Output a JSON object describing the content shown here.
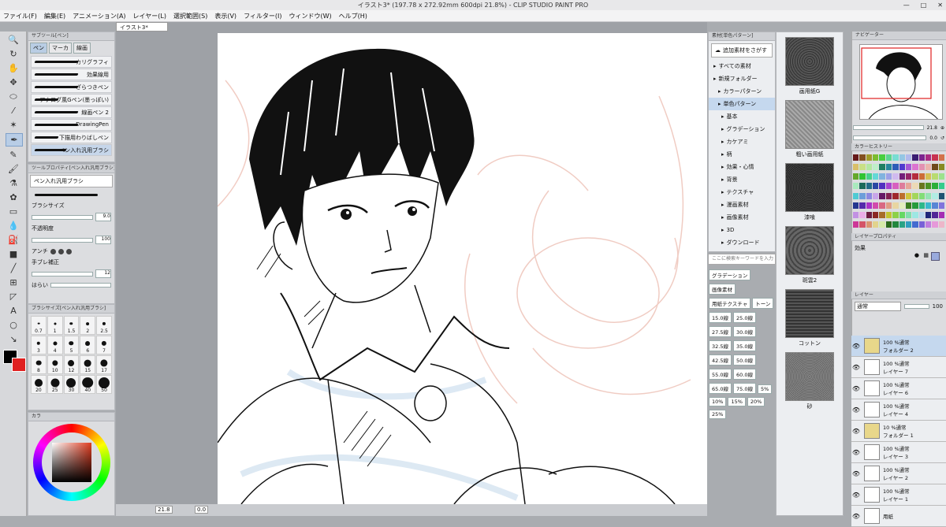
{
  "window": {
    "title": "イラスト3* (197.78 x 272.92mm 600dpi 21.8%) - CLIP STUDIO PAINT PRO"
  },
  "menu": [
    "ファイル(F)",
    "編集(E)",
    "アニメーション(A)",
    "レイヤー(L)",
    "選択範囲(S)",
    "表示(V)",
    "フィルター(I)",
    "ウィンドウ(W)",
    "ヘルプ(H)"
  ],
  "subtool": {
    "header": "サブツール[ペン]",
    "tabs": [
      "ペン",
      "マーカ",
      "線画"
    ],
    "brushes": [
      "カリグラフィ",
      "効果線用",
      "ざらつきペン",
      "アナログ風Gペン(墨っぽい)",
      "線画ペン 2",
      "DrawingPen",
      "下描用わりばしペン",
      "ペン入れ汎用ブラシ"
    ]
  },
  "toolprop": {
    "header": "ツールプロパティ[ペン入れ汎用ブラシ]",
    "name": "ペン入れ汎用ブラシ",
    "rows": [
      {
        "label": "ブラシサイズ",
        "value": "9.0"
      },
      {
        "label": "不透明度",
        "value": "100"
      },
      {
        "label": "アンチ",
        "value": ""
      },
      {
        "label": "手ブレ補正",
        "value": "12"
      },
      {
        "label": "はらい",
        "value": ""
      }
    ]
  },
  "brushsize": {
    "header": "ブラシサイズ[ペン入れ汎用ブラシ]",
    "sizes": [
      "0.7",
      "1",
      "1.5",
      "2",
      "2.5",
      "3",
      "4",
      "5",
      "6",
      "7",
      "8",
      "10",
      "12",
      "15",
      "17",
      "20",
      "25",
      "30",
      "40",
      "50"
    ]
  },
  "colorwheel": {
    "header": "カラ"
  },
  "document": {
    "tab": "イラスト3*"
  },
  "status": {
    "zoom": "21.8",
    "rotation": "0.0"
  },
  "material": {
    "header": "素材[単色パターン]",
    "add": "追加素材をさがす",
    "tree": [
      {
        "label": "すべての素材",
        "sel": false
      },
      {
        "label": "新規フォルダー",
        "sel": false
      },
      {
        "label": "カラーパターン",
        "sel": false
      },
      {
        "label": "単色パターン",
        "sel": true
      },
      {
        "label": "基本",
        "sel": false
      },
      {
        "label": "グラデーション",
        "sel": false
      },
      {
        "label": "カケアミ",
        "sel": false
      },
      {
        "label": "柄",
        "sel": false
      },
      {
        "label": "効果・心情",
        "sel": false
      },
      {
        "label": "背景",
        "sel": false
      },
      {
        "label": "テクスチャ",
        "sel": false
      },
      {
        "label": "漫画素材",
        "sel": false
      },
      {
        "label": "画像素材",
        "sel": false
      },
      {
        "label": "3D",
        "sel": false
      },
      {
        "label": "ダウンロード",
        "sel": false
      }
    ],
    "search_placeholder": "ここに検索キーワードを入力",
    "tags": [
      "グラデーション",
      "画像素材",
      "用紙テクスチャ",
      "トーン",
      "15.0線",
      "25.0線",
      "27.5線",
      "30.0線",
      "32.5線",
      "35.0線",
      "42.5線",
      "50.0線",
      "55.0線",
      "60.0線",
      "65.0線",
      "75.0線",
      "5%",
      "10%",
      "15%",
      "20%",
      "25%"
    ],
    "thumbs": [
      "画用紙G",
      "粗い画用紙",
      "漆喰",
      "斑雲2",
      "コットン",
      "砂"
    ]
  },
  "navigator": {
    "header": "ナビゲーター",
    "zoom": "21.8",
    "angle": "0.0"
  },
  "colorhistory": {
    "header": "カラーヒストリー"
  },
  "layerprop": {
    "header": "レイヤープロパティ",
    "effect": "効果"
  },
  "layers": {
    "header": "レイヤー",
    "blend": "通常",
    "opacity": "100",
    "items": [
      {
        "mode": "100 %通常",
        "name": "フォルダー 2",
        "sel": true
      },
      {
        "mode": "100 %通常",
        "name": "レイヤー 7",
        "sel": false
      },
      {
        "mode": "100 %通常",
        "name": "レイヤー 6",
        "sel": false
      },
      {
        "mode": "100 %通常",
        "name": "レイヤー 4",
        "sel": false
      },
      {
        "mode": "10 %通常",
        "name": "フォルダー 1",
        "sel": false
      },
      {
        "mode": "100 %通常",
        "name": "レイヤー 3",
        "sel": false
      },
      {
        "mode": "100 %通常",
        "name": "レイヤー 2",
        "sel": false
      },
      {
        "mode": "100 %通常",
        "name": "レイヤー 1",
        "sel": false
      },
      {
        "mode": "",
        "name": "用紙",
        "sel": false
      }
    ]
  },
  "colors": {
    "main": "#000000",
    "sub": "#e02020",
    "accent": "#b9cde4"
  }
}
